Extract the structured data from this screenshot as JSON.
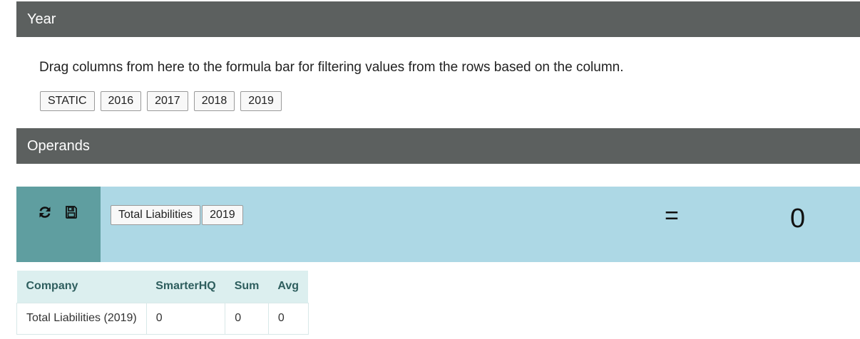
{
  "year_section": {
    "title": "Year",
    "instructions": "Drag columns from here to the formula bar for filtering values from the rows based on the column.",
    "chips": [
      "STATIC",
      "2016",
      "2017",
      "2018",
      "2019"
    ]
  },
  "operands_section": {
    "title": "Operands"
  },
  "formula": {
    "icons": [
      "refresh-icon",
      "save-icon"
    ],
    "chips": [
      "Total Liabilities",
      "2019"
    ],
    "equals": "=",
    "result": "0"
  },
  "results_table": {
    "headers": [
      "Company",
      "SmarterHQ",
      "Sum",
      "Avg"
    ],
    "rows": [
      [
        "Total Liabilities (2019)",
        "0",
        "0",
        "0"
      ]
    ]
  },
  "colors": {
    "header_bg": "#5c605f",
    "formula_bg": "#add8e5",
    "actions_bg": "#5f9ea0",
    "table_header_bg": "#dcefef"
  }
}
